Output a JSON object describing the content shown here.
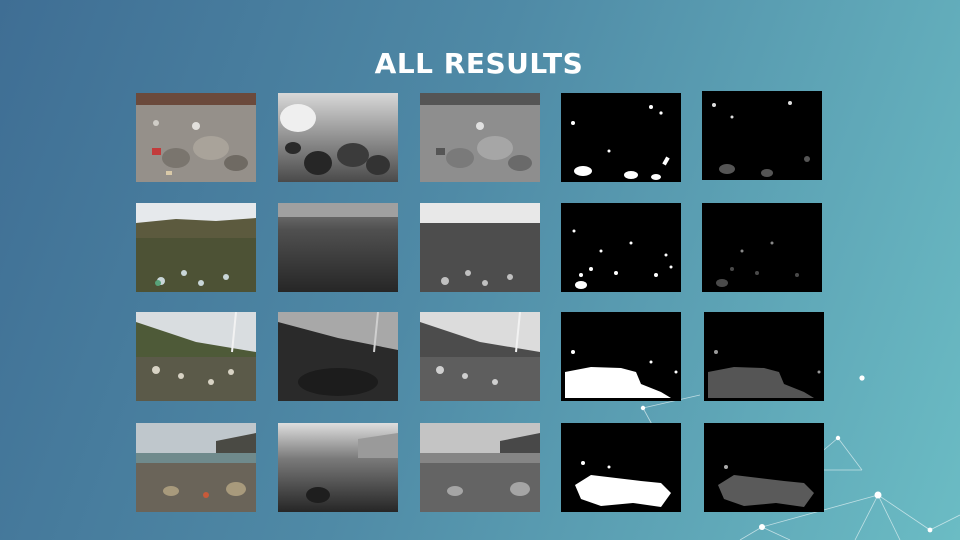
{
  "slide": {
    "title": "ALL RESULTS"
  },
  "grid": {
    "rows": 4,
    "columns": [
      "photo",
      "depth-map",
      "grayscale",
      "binary-mask",
      "masked-depth"
    ]
  },
  "colors": {
    "background_start": "#3f6e94",
    "background_end": "#6bbcc4",
    "title": "#ffffff",
    "network_lines": "#e8f4f6"
  }
}
